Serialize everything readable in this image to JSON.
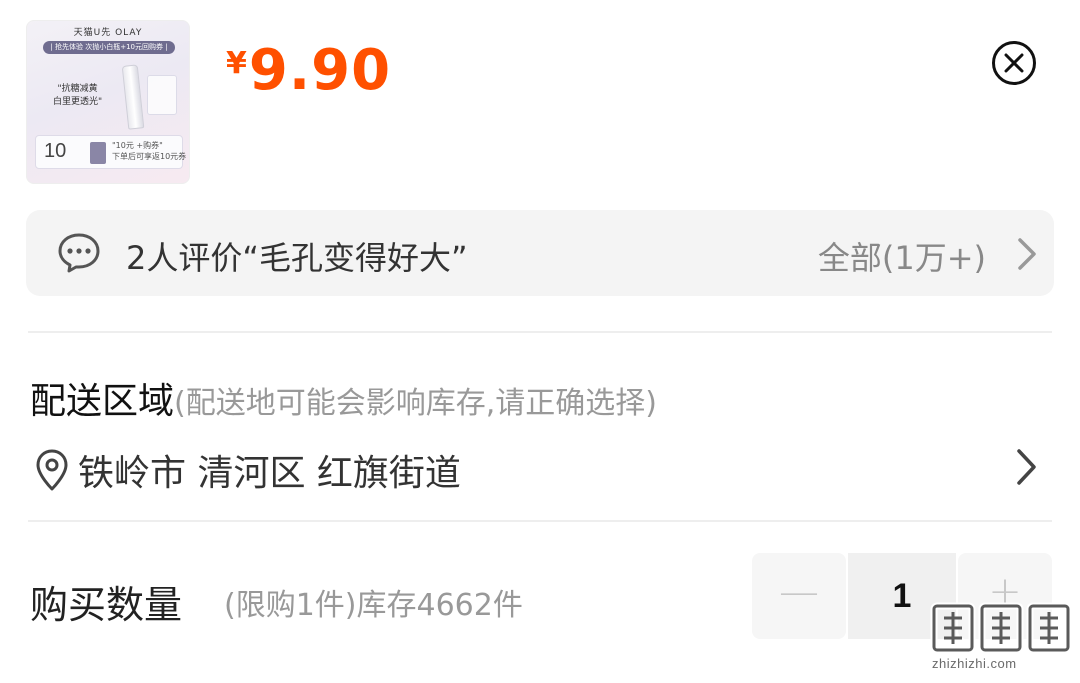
{
  "product": {
    "thumbnail": {
      "brand": "天猫U先  OLAY",
      "banner": "| 抢先体验 次抛小白瓶+10元回购券 |",
      "slogan_line1": "\"抗糖减黄",
      "slogan_line2": "白里更透光\"",
      "coupon_value": "10",
      "coupon_title": "\"10元 +购券\"",
      "coupon_subtitle": "下单后可享返10元券"
    },
    "price_symbol": "¥",
    "price": "9.90"
  },
  "close_icon": "close-circle-icon",
  "review": {
    "icon": "chat-bubble-icon",
    "text": "2人评价“毛孔变得好大”",
    "all_label": "全部(1万+)"
  },
  "delivery": {
    "title": "配送区域",
    "hint": "(配送地可能会影响库存,请正确选择)",
    "address": "铁岭市 清河区 红旗街道",
    "icon": "location-pin-icon"
  },
  "quantity": {
    "title": "购买数量",
    "note": "(限购1件)库存4662件",
    "value": "1",
    "minus_label": "—",
    "plus_label": "+"
  },
  "watermark": {
    "logo_text": "值值值",
    "url": "zhizhizhi.com"
  },
  "colors": {
    "price": "#ff5000",
    "review_bg": "#f4f4f4",
    "muted_text": "#999999"
  }
}
